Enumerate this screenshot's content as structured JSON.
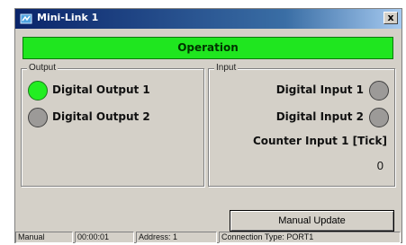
{
  "window": {
    "title": "Mini-Link 1",
    "close_label": "x"
  },
  "status_banner": {
    "text": "Operation",
    "color": "#1fe61f"
  },
  "output_group": {
    "label": "Output",
    "items": [
      {
        "label": "Digital Output 1",
        "state": "on"
      },
      {
        "label": "Digital Output 2",
        "state": "off"
      }
    ]
  },
  "input_group": {
    "label": "Input",
    "items": [
      {
        "label": "Digital Input 1",
        "state": "off"
      },
      {
        "label": "Digital Input 2",
        "state": "off"
      }
    ],
    "counter_label": "Counter Input 1 [Tick]",
    "counter_value": "0"
  },
  "manual_update_button": {
    "label": "Manual Update"
  },
  "statusbar": {
    "mode": "Manual",
    "time": "00:00:01",
    "address": "Address: 1",
    "connection": "Connection Type: PORT1"
  },
  "colors": {
    "led_on": "#22ee22",
    "led_off": "#9c9a98",
    "title_bar": "#0a246a"
  }
}
